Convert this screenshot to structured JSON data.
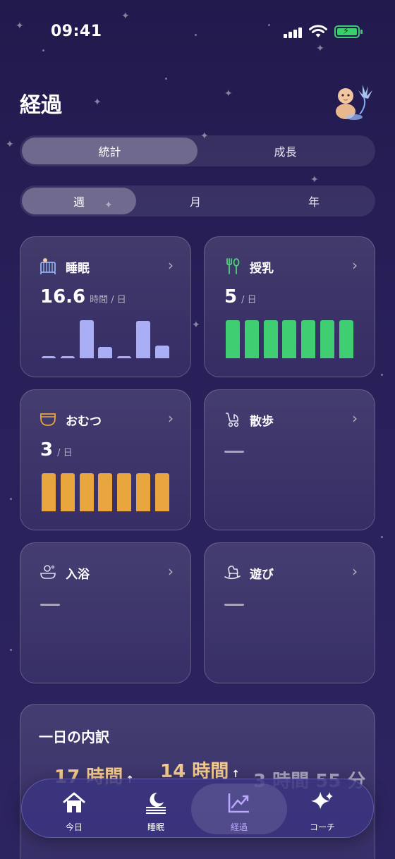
{
  "status_bar": {
    "time": "09:41"
  },
  "header": {
    "title": "経過"
  },
  "segment_primary": {
    "items": [
      "統計",
      "成長"
    ],
    "selected": "統計"
  },
  "segment_period": {
    "items": [
      "週",
      "月",
      "年"
    ],
    "selected": "週"
  },
  "cards": {
    "sleep": {
      "title": "睡眠",
      "value": "16.6",
      "unit": "時間 / 日",
      "icon": "crib-icon",
      "bar_color": "#a9aef5",
      "bar_levels": [
        0.06,
        0.06,
        1.0,
        0.29,
        0.06,
        0.98,
        0.33
      ]
    },
    "feeding": {
      "title": "授乳",
      "value": "5",
      "unit": "/ 日",
      "icon": "fork-spoon-icon",
      "bar_color": "#3fcf72",
      "bar_levels": [
        1,
        1,
        1,
        1,
        1,
        1,
        1
      ]
    },
    "diaper": {
      "title": "おむつ",
      "value": "3",
      "unit": "/ 日",
      "icon": "diaper-icon",
      "bar_color": "#e9a53e",
      "bar_levels": [
        1,
        1,
        1,
        1,
        1,
        1,
        1
      ]
    },
    "walk": {
      "title": "散歩",
      "icon": "stroller-icon"
    },
    "bath": {
      "title": "入浴",
      "icon": "bath-icon"
    },
    "play": {
      "title": "遊び",
      "icon": "rocking-horse-icon"
    }
  },
  "breakdown": {
    "title": "一日の内訳",
    "stats": [
      {
        "value": "17 時間",
        "arrow": "↑"
      },
      {
        "value": "14 時間",
        "arrow": "↑"
      },
      {
        "value": "3 時間 55 分"
      }
    ]
  },
  "tab_bar": {
    "items": [
      {
        "label": "今日",
        "icon": "home-icon"
      },
      {
        "label": "睡眠",
        "icon": "moon-icon"
      },
      {
        "label": "経過",
        "icon": "chart-icon"
      },
      {
        "label": "コーチ",
        "icon": "sparkles-icon"
      }
    ],
    "selected": "経過",
    "accent": "#b9a6ff"
  }
}
